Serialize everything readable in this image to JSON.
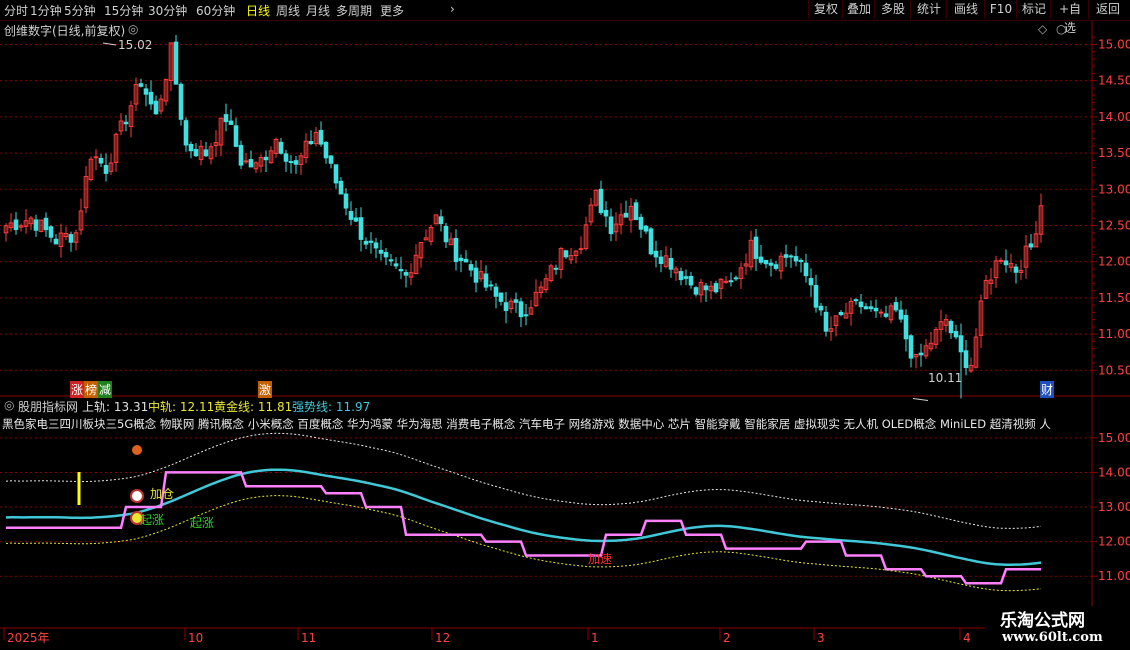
{
  "toolbar": {
    "periods": [
      "分时",
      "1分钟",
      "5分钟",
      "15分钟",
      "30分钟",
      "60分钟",
      "日线",
      "周线",
      "月线",
      "多周期",
      "更多"
    ],
    "active_period": "日线",
    "buttons": [
      "复权",
      "叠加",
      "多股",
      "统计",
      "画线",
      "F10",
      "标记",
      "+自选",
      "返回"
    ]
  },
  "main_panel": {
    "title": "创维数字(日线,前复权)",
    "high_label": "15.02",
    "low_label": "10.11",
    "markers": {
      "zhangting": "涨",
      "bangjian": "榜",
      "jian": "减",
      "ji": "激",
      "cai": "财"
    }
  },
  "indicator_panel": {
    "name": "股朋指标网",
    "upper_label": "上轨:",
    "upper_value": "13.31",
    "middle_label": "中轨:",
    "middle_value": "12.11",
    "gold_label": "黄金线:",
    "gold_value": "11.81",
    "strong_label": "强势线:",
    "strong_value": "11.97",
    "concepts": "黑色家电三四川板块三5G概念 物联网 腾讯概念 小米概念 百度概念 华为鸿蒙 华为海思 消费电子概念 汽车电子 网络游戏 数据中心 芯片 智能穿戴 智能家居 虚拟现实 无人机 OLED概念 MiniLED 超清视频 人",
    "annotations": {
      "jiacang": "加仓",
      "qizhang1": "起涨",
      "qizhang2": "起涨",
      "jiasu": "加速"
    }
  },
  "colors": {
    "up": "#ff3c3c",
    "down": "#40e0e0",
    "grid": "#8b0000",
    "axis_text": "#ff4040",
    "middle_line": "#40c8d8",
    "strong_line": "#ff80ff",
    "band_line": "#e8e8e8",
    "gold_line": "#e8e830"
  },
  "watermark": {
    "line1": "乐淘公式网",
    "line2": "www.60lt.com"
  },
  "chart_data": [
    {
      "type": "candlestick",
      "title": "创维数字(日线,前复权)",
      "ylim": [
        10.2,
        15.2
      ],
      "yticks": [
        10.5,
        11.0,
        11.5,
        12.0,
        12.5,
        13.0,
        13.5,
        14.0,
        14.5,
        15.0
      ],
      "x_ticks": [
        "2025年",
        "10",
        "11",
        "12",
        "1",
        "2",
        "3",
        "4"
      ],
      "annotated_high": 15.02,
      "annotated_low": 10.11,
      "close_path": [
        [
          0,
          12.5
        ],
        [
          5,
          12.6
        ],
        [
          10,
          12.3
        ],
        [
          14,
          12.4
        ],
        [
          17,
          13.5
        ],
        [
          20,
          13.3
        ],
        [
          24,
          14.0
        ],
        [
          27,
          14.5
        ],
        [
          30,
          14.0
        ],
        [
          33,
          14.9
        ],
        [
          36,
          13.6
        ],
        [
          40,
          13.5
        ],
        [
          44,
          14.0
        ],
        [
          47,
          13.4
        ],
        [
          50,
          13.3
        ],
        [
          54,
          13.7
        ],
        [
          58,
          13.3
        ],
        [
          62,
          13.8
        ],
        [
          66,
          13.1
        ],
        [
          70,
          12.5
        ],
        [
          75,
          12.0
        ],
        [
          80,
          11.8
        ],
        [
          83,
          12.3
        ],
        [
          86,
          12.6
        ],
        [
          89,
          12.2
        ],
        [
          93,
          11.9
        ],
        [
          98,
          11.5
        ],
        [
          103,
          11.3
        ],
        [
          107,
          11.6
        ],
        [
          111,
          12.1
        ],
        [
          115,
          12.3
        ],
        [
          118,
          12.9
        ],
        [
          121,
          12.5
        ],
        [
          125,
          12.8
        ],
        [
          129,
          12.2
        ],
        [
          133,
          12.0
        ],
        [
          137,
          11.7
        ],
        [
          141,
          11.6
        ],
        [
          145,
          11.7
        ],
        [
          149,
          12.2
        ],
        [
          153,
          12.0
        ],
        [
          157,
          12.1
        ],
        [
          161,
          11.7
        ],
        [
          164,
          11.0
        ],
        [
          168,
          11.3
        ],
        [
          171,
          11.4
        ],
        [
          175,
          11.2
        ],
        [
          178,
          11.3
        ],
        [
          182,
          10.6
        ],
        [
          185,
          10.9
        ],
        [
          188,
          11.2
        ],
        [
          191,
          10.7
        ],
        [
          193,
          10.6
        ],
        [
          196,
          11.7
        ],
        [
          199,
          12.1
        ],
        [
          202,
          11.9
        ],
        [
          205,
          12.2
        ],
        [
          207,
          12.8
        ]
      ]
    },
    {
      "type": "line",
      "title": "股朋指标网",
      "ylim": [
        10.4,
        15.4
      ],
      "yticks": [
        11.0,
        12.0,
        13.0,
        14.0,
        15.0
      ],
      "series": [
        {
          "name": "上轨",
          "last": 13.31
        },
        {
          "name": "中轨",
          "last": 12.11
        },
        {
          "name": "黄金线",
          "last": 11.81
        },
        {
          "name": "强势线",
          "last": 11.97
        }
      ]
    }
  ]
}
